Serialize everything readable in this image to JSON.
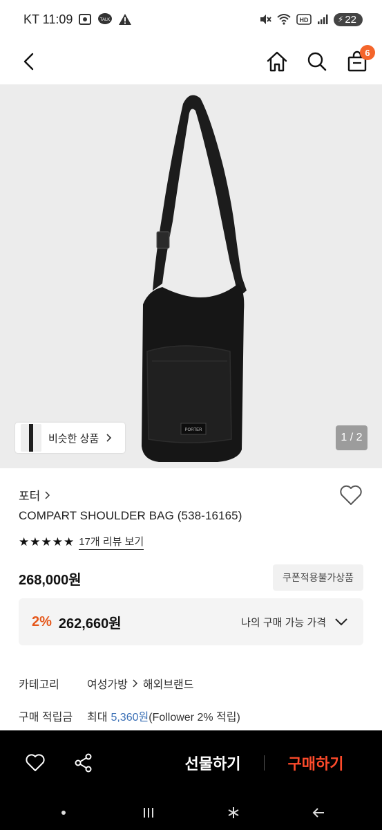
{
  "status_bar": {
    "carrier_time": "KT 11:09",
    "battery": "22",
    "icons": [
      "screen-record-icon",
      "talk-icon",
      "warning-icon",
      "mute-icon",
      "wifi-icon",
      "hd-icon",
      "signal-icon",
      "battery-icon"
    ]
  },
  "header": {
    "icons": [
      "back-icon",
      "home-icon",
      "search-icon",
      "cart-icon"
    ],
    "cart_count": "6"
  },
  "gallery": {
    "similar_label": "비슷한 상품",
    "page_indicator": "1 / 2",
    "logo_text": "PORTER"
  },
  "product": {
    "brand": "포터",
    "name": "COMPART SHOULDER BAG (538-16165)",
    "stars": "★★★★★",
    "review_link": "17개 리뷰 보기",
    "price": "268,000원",
    "coupon_tag": "쿠폰적용불가상품",
    "discount_pct": "2%",
    "discount_price": "262,660원",
    "my_price_label": "나의 구매 가능 가격"
  },
  "meta": {
    "category_label": "카테고리",
    "category_1": "여성가방",
    "category_2": "해외브랜드",
    "points_label": "구매 적립금",
    "points_prefix": "최대",
    "points_value": "5,360원",
    "points_suffix": "(Follower 2% 적립)"
  },
  "action_bar": {
    "gift_label": "선물하기",
    "buy_label": "구매하기",
    "icons": [
      "heart-icon",
      "share-icon"
    ]
  },
  "colors": {
    "accent_orange": "#f4652b",
    "buy_red": "#ff4b2b",
    "discount_orange": "#e5571b",
    "points_blue": "#3a6fb5"
  }
}
